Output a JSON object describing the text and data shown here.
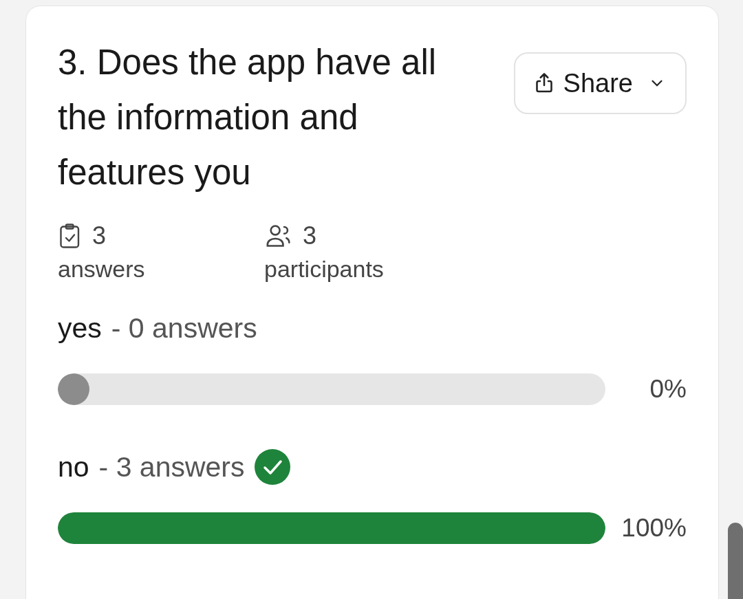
{
  "question": {
    "title": "3. Does the app have all the information and features you",
    "share_button": {
      "label": "Share"
    }
  },
  "stats": [
    {
      "kind": "answers",
      "value": "3",
      "label": "answers"
    },
    {
      "kind": "participants",
      "value": "3",
      "label": "participants"
    }
  ],
  "options": [
    {
      "label": "yes",
      "detail": "- 0 answers",
      "correct": false,
      "level": 0,
      "percent": "0%"
    },
    {
      "label": "no",
      "detail": "- 3 answers",
      "correct": true,
      "level": 1,
      "percent": "100%"
    }
  ]
}
